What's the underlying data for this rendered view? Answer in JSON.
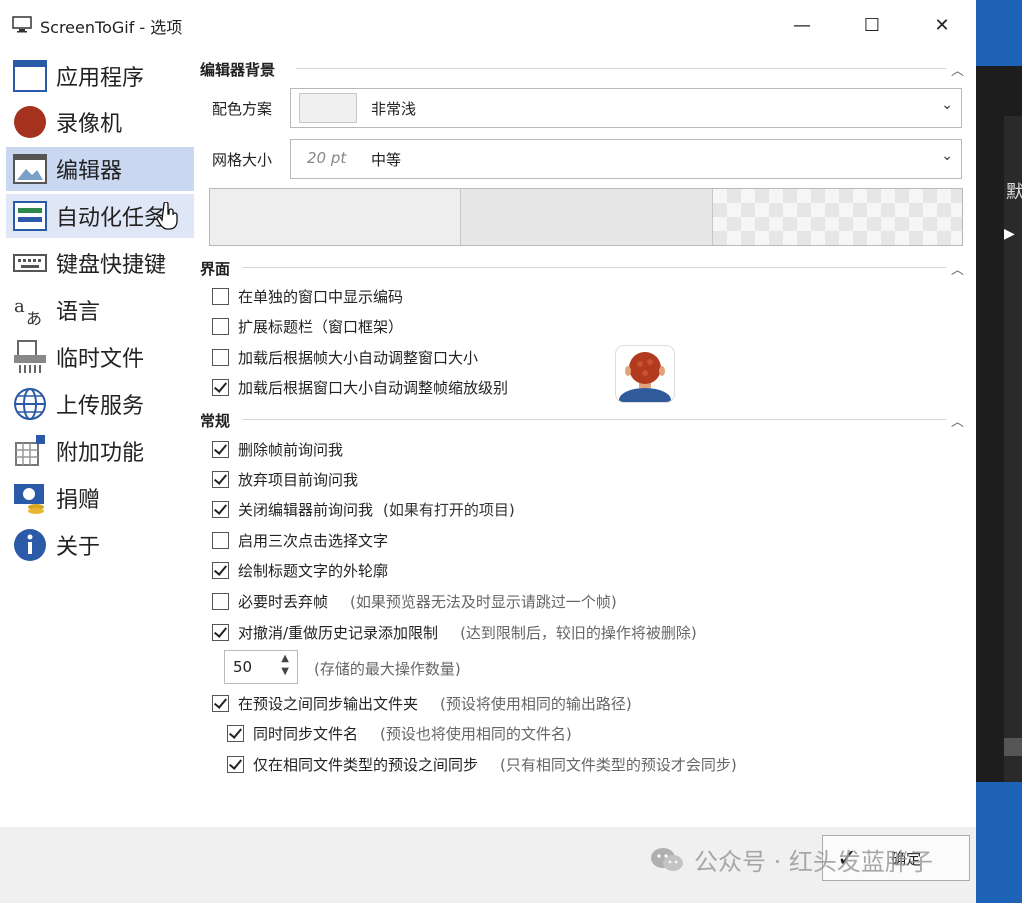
{
  "window": {
    "title": "ScreenToGif - 选项"
  },
  "titlebar": {
    "minimize": "—",
    "maximize": "☐",
    "close": "✕"
  },
  "sidebar": {
    "items": [
      {
        "label": "应用程序",
        "icon": "app-window-icon"
      },
      {
        "label": "录像机",
        "icon": "record-icon"
      },
      {
        "label": "编辑器",
        "icon": "editor-icon",
        "selected": true
      },
      {
        "label": "自动化任务",
        "icon": "automation-icon",
        "hovered": true
      },
      {
        "label": "键盘快捷键",
        "icon": "keyboard-icon"
      },
      {
        "label": "语言",
        "icon": "language-icon"
      },
      {
        "label": "临时文件",
        "icon": "temp-files-icon"
      },
      {
        "label": "上传服务",
        "icon": "globe-icon"
      },
      {
        "label": "附加功能",
        "icon": "extras-icon"
      },
      {
        "label": "捐赠",
        "icon": "donate-icon"
      },
      {
        "label": "关于",
        "icon": "info-icon"
      }
    ]
  },
  "editor_background": {
    "header": "编辑器背景",
    "color_scheme": {
      "label": "配色方案",
      "value": "非常浅"
    },
    "grid_size": {
      "label": "网格大小",
      "pt": "20 pt",
      "value": "中等"
    }
  },
  "interface": {
    "header": "界面",
    "options": [
      {
        "label": "在单独的窗口中显示编码",
        "checked": false
      },
      {
        "label": "扩展标题栏（窗口框架）",
        "checked": false
      },
      {
        "label": "加载后根据帧大小自动调整窗口大小",
        "checked": false
      },
      {
        "label": "加载后根据窗口大小自动调整帧缩放级别",
        "checked": true
      }
    ]
  },
  "general": {
    "header": "常规",
    "options": [
      {
        "label": "删除帧前询问我",
        "checked": true,
        "hint": ""
      },
      {
        "label": "放弃项目前询问我",
        "checked": true,
        "hint": ""
      },
      {
        "label": "关闭编辑器前询问我",
        "checked": true,
        "hint": "(如果有打开的项目)"
      },
      {
        "label": "启用三次点击选择文字",
        "checked": false,
        "hint": ""
      },
      {
        "label": "绘制标题文字的外轮廓",
        "checked": true,
        "hint": ""
      },
      {
        "label": "必要时丢弃帧",
        "checked": false,
        "hint": "(如果预览器无法及时显示请跳过一个帧)"
      },
      {
        "label": "对撤消/重做历史记录添加限制",
        "checked": true,
        "hint": "(达到限制后，较旧的操作将被删除)"
      }
    ],
    "undo_limit": {
      "value": "50",
      "hint": "(存储的最大操作数量)"
    },
    "sync_options": [
      {
        "label": "在预设之间同步输出文件夹",
        "checked": true,
        "hint": "(预设将使用相同的输出路径)"
      },
      {
        "label": "同时同步文件名",
        "checked": true,
        "hint": "(预设也将使用相同的文件名)"
      },
      {
        "label": "仅在相同文件类型的预设之间同步",
        "checked": true,
        "hint": "(只有相同文件类型的预设才会同步)"
      }
    ]
  },
  "footer": {
    "ok_label": "确定"
  },
  "watermark": {
    "text": "公众号 · 红头发蓝胖子"
  },
  "background_window": {
    "text": "默"
  }
}
